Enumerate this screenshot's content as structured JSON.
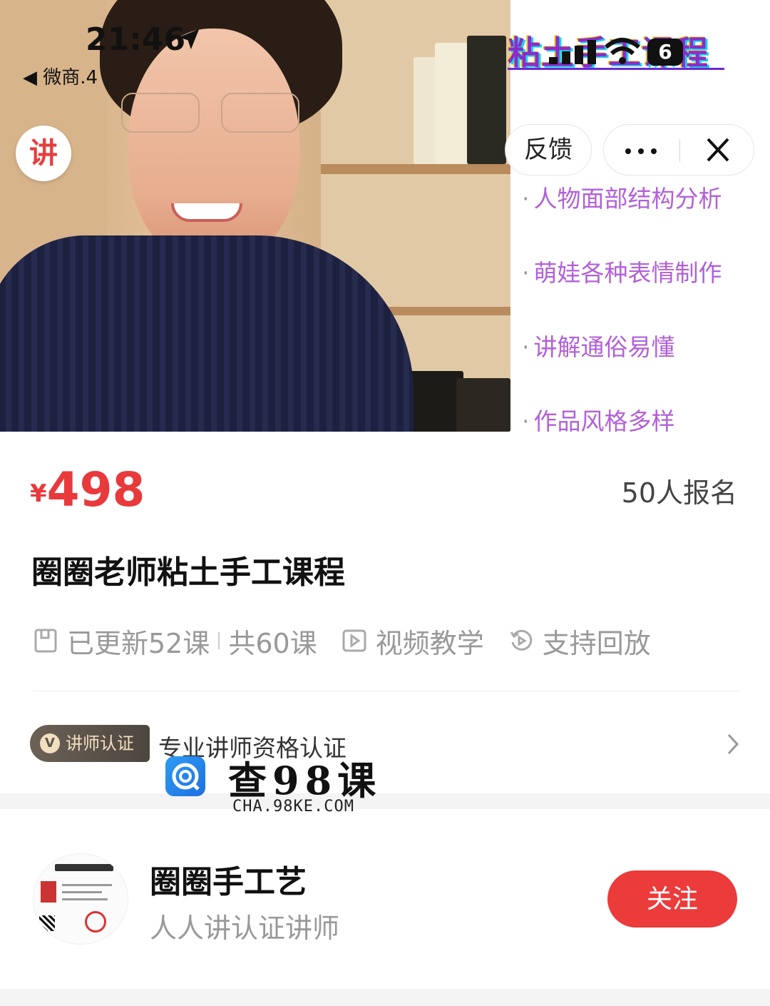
{
  "status_bar": {
    "time": "21:46",
    "back_app": "◀ 微商.4",
    "battery": "6"
  },
  "hero": {
    "banner_title": "粘土手工课程",
    "badge": "讲",
    "bullets": [
      "人物面部结构分析",
      "萌娃各种表情制作",
      "讲解通俗易懂",
      "作品风格多样"
    ],
    "bullet_dot": "·",
    "bullet_color": "#b260d8"
  },
  "top_controls": {
    "feedback_label": "反馈"
  },
  "course": {
    "currency": "¥",
    "price": "498",
    "enrolled": "50人报名",
    "title": "圈圈老师粘土手工课程",
    "updated": "已更新52课",
    "total": "共60课",
    "format": "视频教学",
    "replay": "支持回放"
  },
  "certification": {
    "badge_icon": "V",
    "badge_label": "讲师认证",
    "text": "专业讲师资格认证"
  },
  "watermark": {
    "title": "查98课",
    "url": "CHA.98KE.COM"
  },
  "teacher": {
    "name": "圈圈手工艺",
    "subtitle": "人人讲认证讲师",
    "follow_label": "关注"
  },
  "colors": {
    "accent_red": "#e8393b",
    "follow_button": "#ec3b3b",
    "muted_text": "#999999"
  }
}
